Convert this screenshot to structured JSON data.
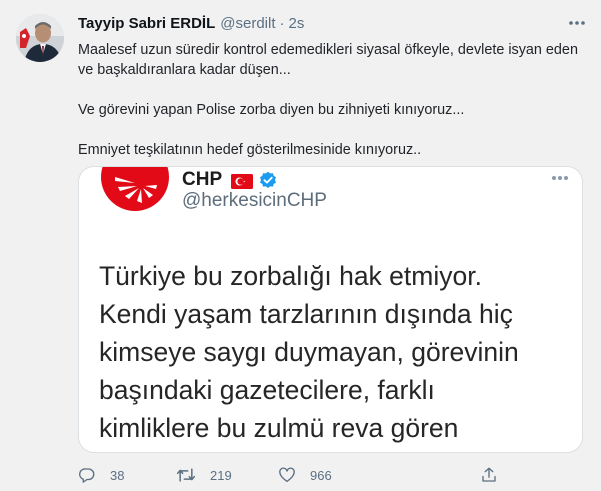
{
  "tweet": {
    "display_name": "Tayyip Sabri ERDİL",
    "handle": "@serdilt",
    "separator": "·",
    "time": "2s",
    "paragraphs": [
      "Maalesef uzun süredir kontrol edemedikleri siyasal öfkeyle, devlete isyan eden ve başkaldıranlara kadar düşen...",
      "Ve görevini yapan Polise zorba diyen bu zihniyeti kınıyoruz...",
      "Emniyet teşkilatının hedef gösterilmesinide kınıyoruz.."
    ]
  },
  "quoted": {
    "name": "CHP",
    "handle": "@herkesicinCHP",
    "body_lines": [
      "Türkiye bu zorbalığı hak etmiyor.",
      "Kendi yaşam tarzlarının dışında hiç",
      "kimseye saygı duymayan, görevinin",
      "başındaki gazetecilere, farklı",
      "kimliklere bu zulmü reva gören"
    ]
  },
  "actions": {
    "reply_count": "38",
    "retweet_count": "219",
    "like_count": "966"
  },
  "colors": {
    "background": "#f1f1f1",
    "secondary_text": "#5b7083",
    "verified_blue": "#1d9bf0",
    "chp_red": "#e30a17"
  },
  "icons": [
    "more-icon",
    "verified-icon",
    "turkey-flag-icon",
    "reply-icon",
    "retweet-icon",
    "like-icon",
    "share-icon"
  ]
}
